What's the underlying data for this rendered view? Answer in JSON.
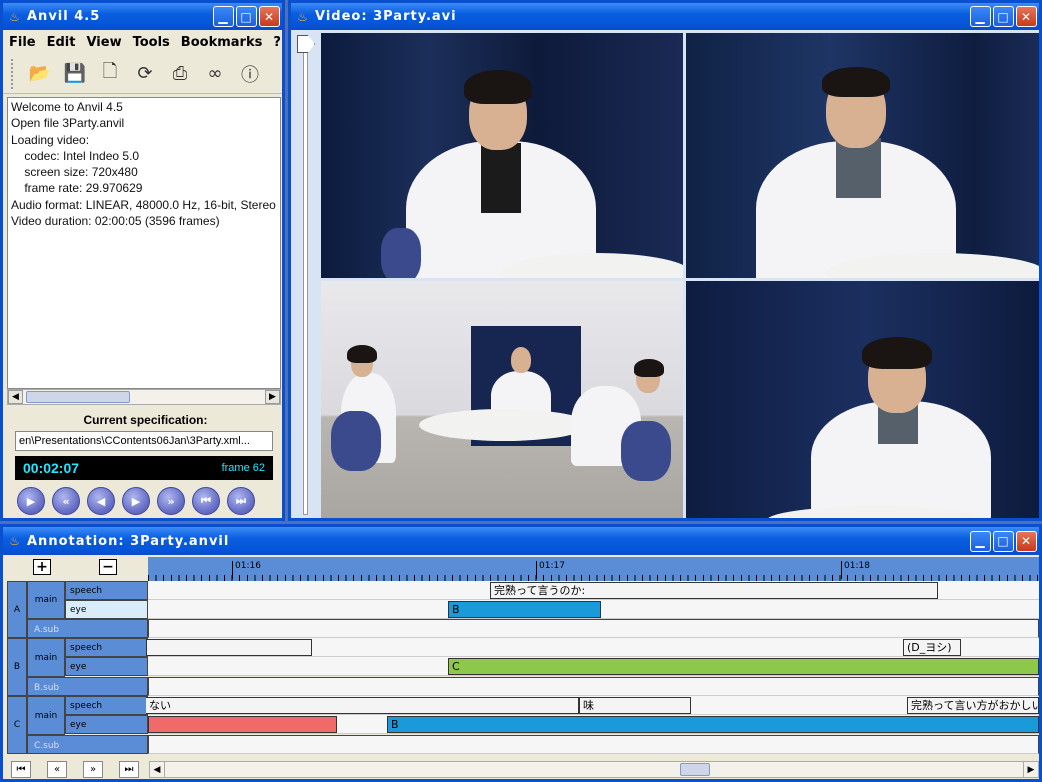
{
  "anvil": {
    "title": "Anvil 4.5",
    "menu": [
      "File",
      "Edit",
      "View",
      "Tools",
      "Bookmarks",
      "?"
    ],
    "log": [
      "Welcome to Anvil 4.5",
      "Open file 3Party.anvil",
      "Loading video:",
      "    codec: Intel Indeo 5.0",
      "    screen size: 720x480",
      "    frame rate: 29.970629",
      "Audio format: LINEAR, 48000.0 Hz, 16-bit, Stereo",
      "Video duration: 02:00:05 (3596 frames)"
    ],
    "spec_label": "Current specification:",
    "spec_path": "...en\\Presentations\\CContents06Jan\\3Party.xml",
    "time": "00:02:07",
    "frame": "frame 62"
  },
  "video": {
    "title": "Video: 3Party.avi"
  },
  "annotation": {
    "title": "Annotation: 3Party.anvil",
    "ruler": [
      "01:16",
      "01:17",
      "01:18"
    ],
    "groups": [
      {
        "name": "A",
        "track": "main",
        "tracks": [
          "speech",
          "eye"
        ],
        "sub": "A.sub"
      },
      {
        "name": "B",
        "track": "main",
        "tracks": [
          "speech",
          "eye"
        ],
        "sub": "B.sub"
      },
      {
        "name": "C",
        "track": "main",
        "tracks": [
          "speech",
          "eye"
        ],
        "sub": "C.sub"
      }
    ],
    "elements": {
      "a_speech": "完熟って言うのか:",
      "a_eye": "B",
      "b_speech": "(D_ヨシ)",
      "b_eye": "C",
      "c_speech_1": "ない",
      "c_speech_2": "味",
      "c_speech_3": "完熟って言い方がおかしい",
      "c_eye": "B"
    },
    "colors": {
      "blue": "#1a9ad8",
      "green": "#8cc84a",
      "red": "#f06a6a",
      "header": "#5b8dd6"
    }
  }
}
